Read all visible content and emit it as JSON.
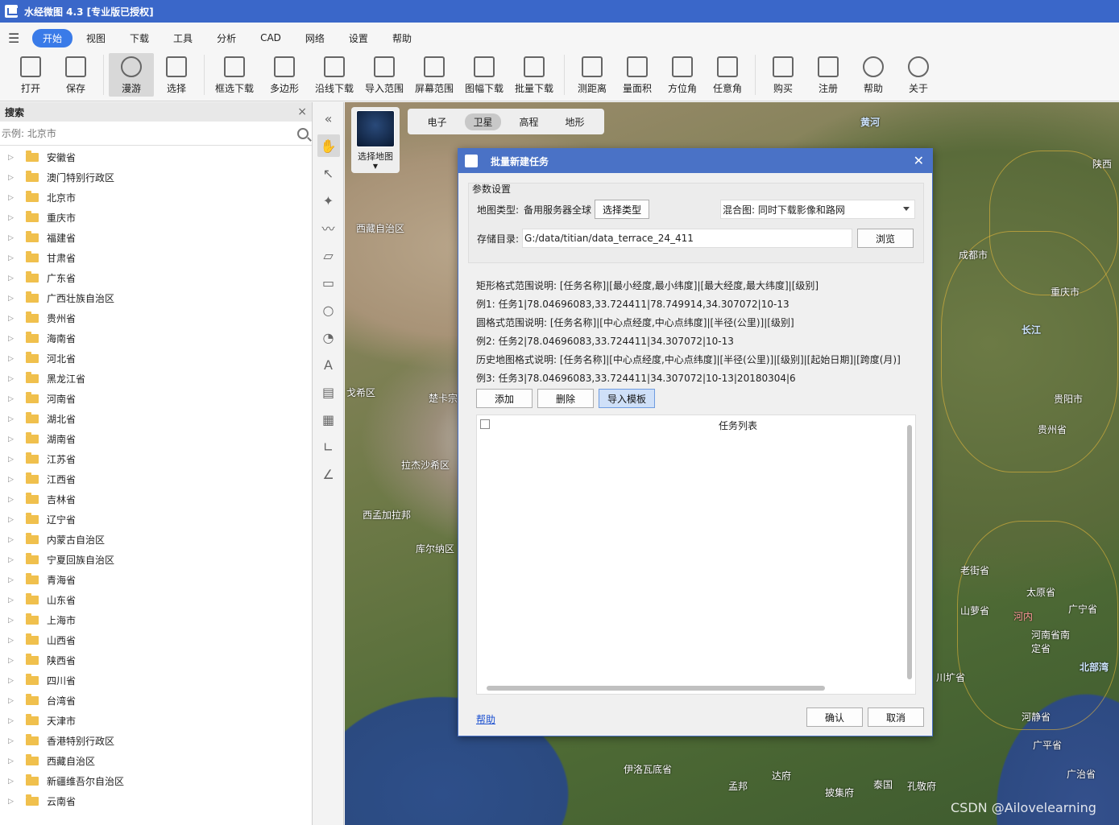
{
  "app": {
    "title": "水经微图 4.3 [专业版已授权]"
  },
  "menu": [
    "开始",
    "视图",
    "下载",
    "工具",
    "分析",
    "CAD",
    "网络",
    "设置",
    "帮助"
  ],
  "toolbar": [
    {
      "label": "打开",
      "icon": "folder-open-icon"
    },
    {
      "label": "保存",
      "icon": "save-icon"
    },
    {
      "label": "漫游",
      "icon": "hand-icon",
      "active": true
    },
    {
      "label": "选择",
      "icon": "pointer-icon"
    },
    {
      "label": "框选下载",
      "icon": "box-download-icon"
    },
    {
      "label": "多边形",
      "icon": "polygon-icon"
    },
    {
      "label": "沿线下载",
      "icon": "line-download-icon"
    },
    {
      "label": "导入范围",
      "icon": "import-icon"
    },
    {
      "label": "屏幕范围",
      "icon": "screen-icon"
    },
    {
      "label": "图幅下载",
      "icon": "grid-icon"
    },
    {
      "label": "批量下载",
      "icon": "batch-download-icon"
    },
    {
      "label": "测距离",
      "icon": "ruler-icon"
    },
    {
      "label": "量面积",
      "icon": "area-icon"
    },
    {
      "label": "方位角",
      "icon": "azimuth-icon"
    },
    {
      "label": "任意角",
      "icon": "angle-icon"
    },
    {
      "label": "购买",
      "icon": "cart-icon"
    },
    {
      "label": "注册",
      "icon": "lock-icon"
    },
    {
      "label": "帮助",
      "icon": "help-icon"
    },
    {
      "label": "关于",
      "icon": "info-icon"
    }
  ],
  "search": {
    "title": "搜索",
    "placeholder": "示例: 北京市"
  },
  "provinces": [
    "安徽省",
    "澳门特别行政区",
    "北京市",
    "重庆市",
    "福建省",
    "甘肃省",
    "广东省",
    "广西壮族自治区",
    "贵州省",
    "海南省",
    "河北省",
    "黑龙江省",
    "河南省",
    "湖北省",
    "湖南省",
    "江苏省",
    "江西省",
    "吉林省",
    "辽宁省",
    "内蒙古自治区",
    "宁夏回族自治区",
    "青海省",
    "山东省",
    "上海市",
    "山西省",
    "陕西省",
    "四川省",
    "台湾省",
    "天津市",
    "香港特别行政区",
    "西藏自治区",
    "新疆维吾尔自治区",
    "云南省"
  ],
  "map": {
    "layer_select": "选择地图",
    "tabs": [
      "电子",
      "卫星",
      "高程",
      "地形"
    ],
    "active_tab": "卫星",
    "labels": [
      {
        "text": "西藏自治区"
      },
      {
        "text": "成都市"
      },
      {
        "text": "重庆市"
      },
      {
        "text": "贵阳市"
      },
      {
        "text": "贵州省"
      },
      {
        "text": "戈希区"
      },
      {
        "text": "楚卡宗"
      },
      {
        "text": "拉杰沙希区"
      },
      {
        "text": "西孟加拉邦"
      },
      {
        "text": "库尔纳区"
      },
      {
        "text": "老街省"
      },
      {
        "text": "太原省"
      },
      {
        "text": "山萝省"
      },
      {
        "text": "广宁省"
      },
      {
        "text": "河南省南定省"
      },
      {
        "text": "川圹省"
      },
      {
        "text": "河静省"
      },
      {
        "text": "伊洛瓦底省"
      },
      {
        "text": "孟邦"
      },
      {
        "text": "泰国"
      },
      {
        "text": "孔敬府"
      },
      {
        "text": "披集府"
      },
      {
        "text": "广平省"
      },
      {
        "text": "广治省"
      },
      {
        "text": "黄河"
      },
      {
        "text": "长江"
      },
      {
        "text": "陕西"
      },
      {
        "text": "北部湾"
      },
      {
        "text": "河内"
      },
      {
        "text": "达府"
      }
    ]
  },
  "dialog": {
    "title": "批量新建任务",
    "params_title": "参数设置",
    "map_type_label": "地图类型:",
    "map_type_value": "备用服务器全球",
    "select_type_btn": "选择类型",
    "mix_value": "混合图: 同时下载影像和路网",
    "dir_label": "存储目录:",
    "dir_value": "G:/data/titian/data_terrace_24_411",
    "browse_btn": "浏览",
    "desc": [
      "矩形格式范围说明:  [任务名称]|[最小经度,最小纬度]|[最大经度,最大纬度]|[级别]",
      "例1: 任务1|78.04696083,33.724411|78.749914,34.307072|10-13",
      "圆格式范围说明:  [任务名称]|[中心点经度,中心点纬度]|[半径(公里)]|[级别]",
      "例2: 任务2|78.04696083,33.724411|34.307072|10-13",
      "历史地图格式说明:  [任务名称]|[中心点经度,中心点纬度]|[半径(公里)]|[级别]|[起始日期]|[跨度(月)]",
      "例3: 任务3|78.04696083,33.724411|34.307072|10-13|20180304|6"
    ],
    "add_btn": "添加",
    "delete_btn": "删除",
    "import_btn": "导入模板",
    "list_header": "任务列表",
    "help_link": "帮助",
    "ok_btn": "确认",
    "cancel_btn": "取消"
  },
  "watermark": "CSDN @Ailovelearning"
}
